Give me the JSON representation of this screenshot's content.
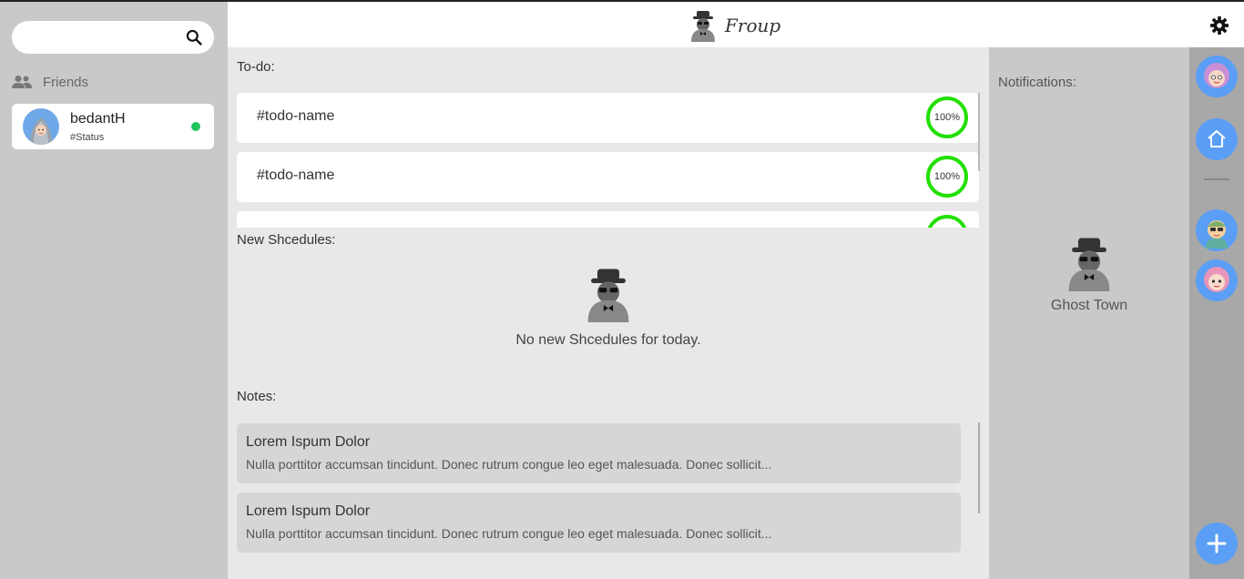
{
  "search": {
    "placeholder": "",
    "value": ""
  },
  "friends": {
    "heading": "Friends",
    "list": [
      {
        "name": "bedantH",
        "status": "#Status",
        "online": true
      }
    ]
  },
  "brand": {
    "name": "Froup"
  },
  "todo": {
    "heading": "To-do:",
    "items": [
      {
        "name": "#todo-name",
        "progress": "100%"
      },
      {
        "name": "#todo-name",
        "progress": "100%"
      },
      {
        "name": "",
        "progress": ""
      }
    ]
  },
  "schedules": {
    "heading": "New Shcedules:",
    "empty_message": "No new Shcedules for today."
  },
  "notes": {
    "heading": "Notes:",
    "items": [
      {
        "title": "Lorem Ispum Dolor",
        "body": "Nulla porttitor accumsan tincidunt. Donec rutrum congue leo eget malesuada. Donec sollicit..."
      },
      {
        "title": "Lorem Ispum Dolor",
        "body": "Nulla porttitor accumsan tincidunt. Donec rutrum congue leo eget malesuada. Donec sollicit..."
      }
    ]
  },
  "notifications": {
    "heading": "Notifications:",
    "empty_message": "Ghost Town"
  },
  "colors": {
    "accent": "#5b9ef5",
    "progress_ring": "#22e000",
    "online": "#22c55e"
  },
  "icons": [
    "search-icon",
    "people-icon",
    "gear-icon",
    "home-icon",
    "plus-icon",
    "ghost-mascot-icon"
  ]
}
